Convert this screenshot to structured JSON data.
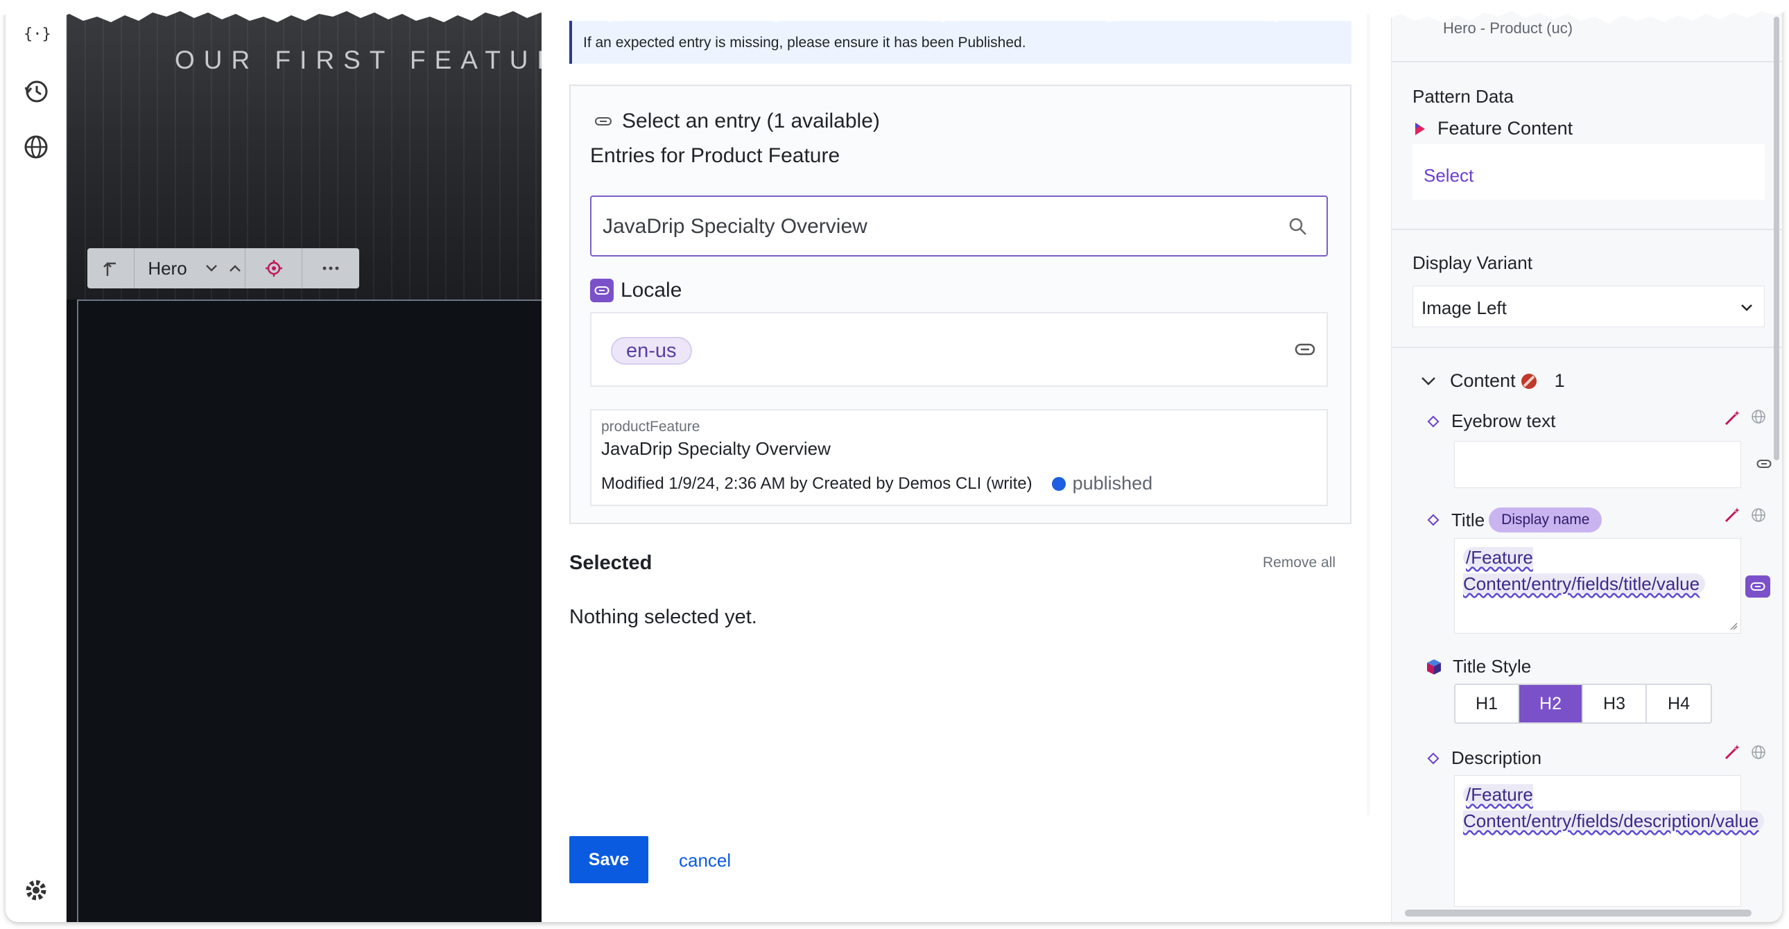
{
  "rail": {
    "icons": [
      "code-braces-icon",
      "history-icon",
      "globe-icon",
      "settings-gear-icon"
    ],
    "top_glyph": "{···}"
  },
  "preview": {
    "hero_title": "OUR FIRST FEATURE",
    "toolbar": {
      "block_name": "Hero"
    }
  },
  "entry_selector": {
    "info_banner": "If an expected entry is missing, please ensure it has been Published.",
    "heading": "Select an entry (1 available)",
    "subheading": "Entries for Product Feature",
    "search": {
      "value": "JavaDrip Specialty Overview"
    },
    "locale_label": "Locale",
    "locale_value": "en-us",
    "entry": {
      "type": "productFeature",
      "name": "JavaDrip Specialty Overview",
      "modified": "Modified 1/9/24, 2:36 AM by Created by Demos CLI (write)",
      "status": "published"
    },
    "selected_title": "Selected",
    "remove_all": "Remove all",
    "empty_message": "Nothing selected yet.",
    "save_label": "Save",
    "cancel_label": "cancel"
  },
  "properties": {
    "top_text": "Hero - Product (uc)",
    "pattern_data_label": "Pattern Data",
    "feature_content": "Feature Content",
    "select_label": "Select",
    "display_variant_label": "Display Variant",
    "display_variant_value": "Image Left",
    "content_label": "Content",
    "content_count": "1",
    "eyebrow_label": "Eyebrow text",
    "title_label": "Title",
    "title_pill": "Display name",
    "title_binding": "/Feature Content/entry/fields/title/value",
    "title_style_label": "Title Style",
    "title_styles": [
      "H1",
      "H2",
      "H3",
      "H4"
    ],
    "title_style_active": "H2",
    "description_label": "Description",
    "description_binding": "/Feature Content/entry/fields/description/value"
  },
  "colors": {
    "accent_purple": "#7b51c9",
    "primary_blue": "#0a5be0",
    "status_published": "#1d5fe0"
  }
}
